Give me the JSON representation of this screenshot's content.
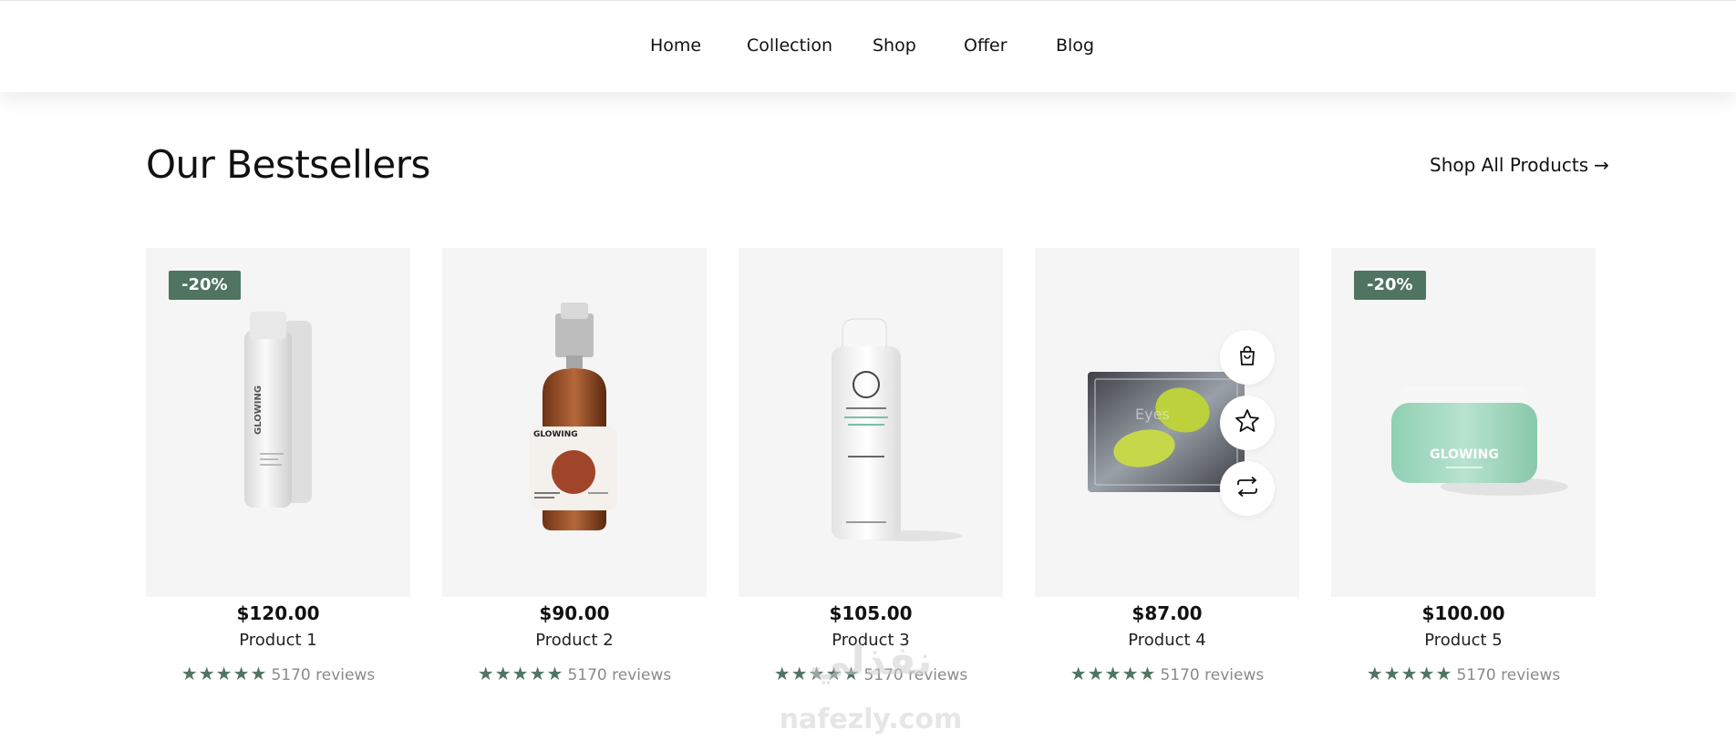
{
  "nav": {
    "items": [
      {
        "label": "Home"
      },
      {
        "label": "Collection"
      },
      {
        "label": "Shop"
      },
      {
        "label": "Offer"
      },
      {
        "label": "Blog"
      }
    ]
  },
  "section": {
    "title": "Our Bestsellers",
    "shop_all_label": "Shop All Products",
    "shop_all_icon": "arrow-right-icon"
  },
  "products": [
    {
      "price": "$120.00",
      "name": "Product 1",
      "reviews": "5170 reviews",
      "rating": 5,
      "badge": "-20%",
      "brand": "GLOWING"
    },
    {
      "price": "$90.00",
      "name": "Product 2",
      "reviews": "5170 reviews",
      "rating": 5,
      "brand": "GLOWING"
    },
    {
      "price": "$105.00",
      "name": "Product 3",
      "reviews": "5170 reviews",
      "rating": 5
    },
    {
      "price": "$87.00",
      "name": "Product 4",
      "reviews": "5170 reviews",
      "rating": 5
    },
    {
      "price": "$100.00",
      "name": "Product 5",
      "reviews": "5170 reviews",
      "rating": 5,
      "badge": "-20%",
      "brand": "GLOWING"
    }
  ],
  "product_actions": [
    {
      "icon": "shopping-bag-icon"
    },
    {
      "icon": "star-outline-icon"
    },
    {
      "icon": "compare-arrows-icon"
    }
  ],
  "watermark": {
    "arabic": "نفذلي",
    "latin": "nafezly.com"
  },
  "colors": {
    "accent": "#4f7461",
    "card_bg": "#f5f5f5",
    "text": "#111111",
    "muted": "#8a8a8a"
  }
}
